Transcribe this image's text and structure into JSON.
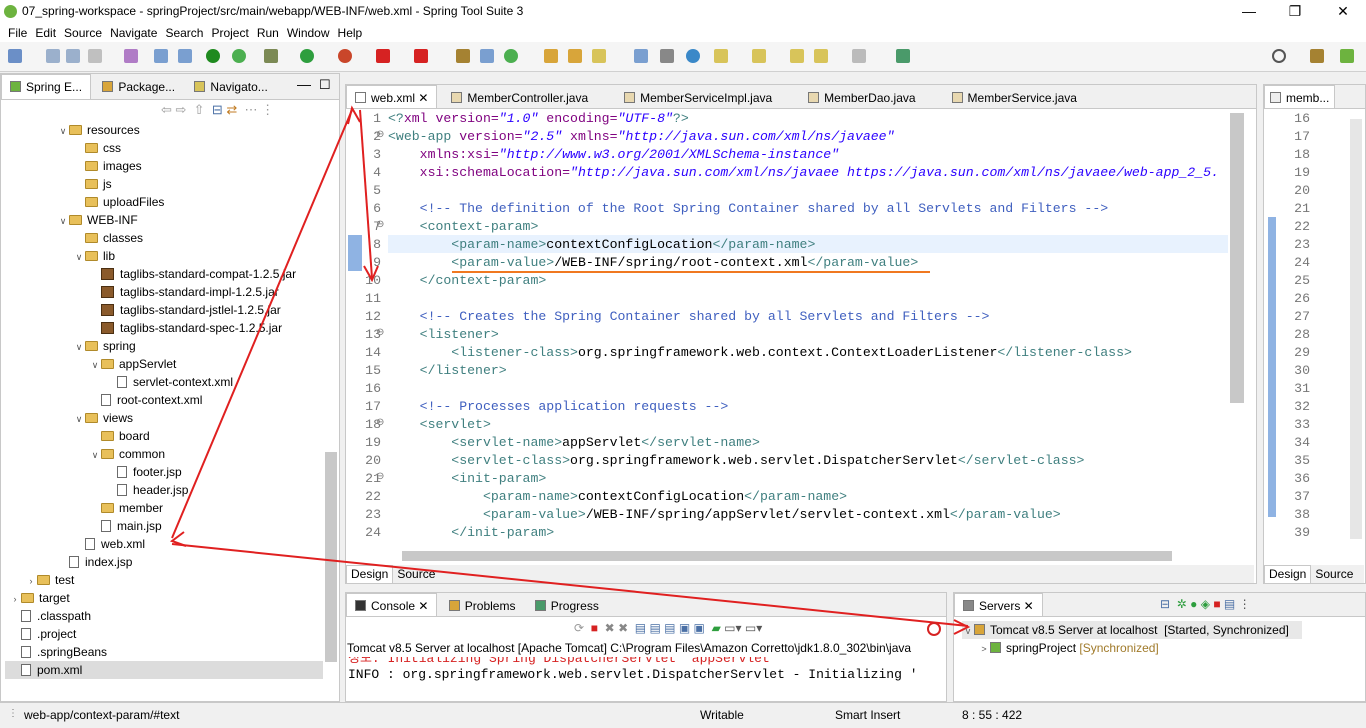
{
  "window": {
    "title": "07_spring-workspace - springProject/src/main/webapp/WEB-INF/web.xml - Spring Tool Suite 3"
  },
  "menu": [
    "File",
    "Edit",
    "Source",
    "Navigate",
    "Search",
    "Project",
    "Run",
    "Window",
    "Help"
  ],
  "left_tabs": [
    "Spring E...",
    "Package...",
    "Navigato..."
  ],
  "tree": [
    {
      "indent": 5,
      "arrow": "v",
      "icon": "folder",
      "label": "resources"
    },
    {
      "indent": 6,
      "arrow": "",
      "icon": "folder",
      "label": "css"
    },
    {
      "indent": 6,
      "arrow": "",
      "icon": "folder",
      "label": "images"
    },
    {
      "indent": 6,
      "arrow": "",
      "icon": "folder",
      "label": "js"
    },
    {
      "indent": 6,
      "arrow": "",
      "icon": "folder",
      "label": "uploadFiles"
    },
    {
      "indent": 5,
      "arrow": "v",
      "icon": "folder",
      "label": "WEB-INF"
    },
    {
      "indent": 6,
      "arrow": "",
      "icon": "folder",
      "label": "classes"
    },
    {
      "indent": 6,
      "arrow": "v",
      "icon": "folder",
      "label": "lib"
    },
    {
      "indent": 7,
      "arrow": "",
      "icon": "jar",
      "label": "taglibs-standard-compat-1.2.5.jar"
    },
    {
      "indent": 7,
      "arrow": "",
      "icon": "jar",
      "label": "taglibs-standard-impl-1.2.5.jar"
    },
    {
      "indent": 7,
      "arrow": "",
      "icon": "jar",
      "label": "taglibs-standard-jstlel-1.2.5.jar"
    },
    {
      "indent": 7,
      "arrow": "",
      "icon": "jar",
      "label": "taglibs-standard-spec-1.2.5.jar"
    },
    {
      "indent": 6,
      "arrow": "v",
      "icon": "folder",
      "label": "spring"
    },
    {
      "indent": 7,
      "arrow": "v",
      "icon": "folder",
      "label": "appServlet"
    },
    {
      "indent": 8,
      "arrow": "",
      "icon": "file",
      "label": "servlet-context.xml"
    },
    {
      "indent": 7,
      "arrow": "",
      "icon": "file",
      "label": "root-context.xml"
    },
    {
      "indent": 6,
      "arrow": "v",
      "icon": "folder",
      "label": "views"
    },
    {
      "indent": 7,
      "arrow": "",
      "icon": "folder",
      "label": "board"
    },
    {
      "indent": 7,
      "arrow": "v",
      "icon": "folder",
      "label": "common"
    },
    {
      "indent": 8,
      "arrow": "",
      "icon": "file",
      "label": "footer.jsp"
    },
    {
      "indent": 8,
      "arrow": "",
      "icon": "file",
      "label": "header.jsp"
    },
    {
      "indent": 7,
      "arrow": "",
      "icon": "folder",
      "label": "member"
    },
    {
      "indent": 7,
      "arrow": "",
      "icon": "file",
      "label": "main.jsp"
    },
    {
      "indent": 6,
      "arrow": "",
      "icon": "file",
      "label": "web.xml"
    },
    {
      "indent": 5,
      "arrow": "",
      "icon": "file",
      "label": "index.jsp"
    },
    {
      "indent": 3,
      "arrow": ">",
      "icon": "folder",
      "label": "test"
    },
    {
      "indent": 2,
      "arrow": ">",
      "icon": "folder",
      "label": "target"
    },
    {
      "indent": 2,
      "arrow": "",
      "icon": "file",
      "label": ".classpath"
    },
    {
      "indent": 2,
      "arrow": "",
      "icon": "file",
      "label": ".project"
    },
    {
      "indent": 2,
      "arrow": "",
      "icon": "file",
      "label": ".springBeans"
    },
    {
      "indent": 2,
      "arrow": "",
      "icon": "file",
      "label": "pom.xml"
    }
  ],
  "editor_tabs": [
    "web.xml",
    "MemberController.java",
    "MemberServiceImpl.java",
    "MemberDao.java",
    "MemberService.java"
  ],
  "right_tab": "memb...",
  "code": [
    {
      "n": "1",
      "fold": "",
      "parts": [
        [
          "tg",
          "<?"
        ],
        [
          "an",
          "xml "
        ],
        [
          "an",
          "version="
        ],
        [
          "av",
          "\"1.0\""
        ],
        [
          "an",
          " encoding="
        ],
        [
          "av",
          "\"UTF-8\""
        ],
        [
          "tg",
          "?>"
        ]
      ]
    },
    {
      "n": "2",
      "fold": "⊖",
      "parts": [
        [
          "tg",
          "<web-app "
        ],
        [
          "an",
          "version="
        ],
        [
          "av",
          "\"2.5\""
        ],
        [
          "an",
          " xmlns="
        ],
        [
          "av",
          "\"http://java.sun.com/xml/ns/javaee\""
        ]
      ]
    },
    {
      "n": "3",
      "fold": "",
      "parts": [
        [
          "an",
          "    xmlns:xsi="
        ],
        [
          "av",
          "\"http://www.w3.org/2001/XMLSchema-instance\""
        ]
      ]
    },
    {
      "n": "4",
      "fold": "",
      "parts": [
        [
          "an",
          "    xsi:schemaLocation="
        ],
        [
          "av",
          "\"http://java.sun.com/xml/ns/javaee https://java.sun.com/xml/ns/javaee/web-app_2_5."
        ]
      ]
    },
    {
      "n": "5",
      "fold": "",
      "parts": []
    },
    {
      "n": "6",
      "fold": "",
      "parts": [
        [
          "cm",
          "    <!-- The definition of the Root Spring Container shared by all Servlets and Filters -->"
        ]
      ]
    },
    {
      "n": "7",
      "fold": "⊖",
      "parts": [
        [
          "tg",
          "    <context-param>"
        ]
      ]
    },
    {
      "n": "8",
      "fold": "",
      "parts": [
        [
          "tg",
          "        <param-name>"
        ],
        [
          "tx",
          "contextConfigLocation"
        ],
        [
          "tg",
          "</param-name>"
        ]
      ]
    },
    {
      "n": "9",
      "fold": "",
      "parts": [
        [
          "tg",
          "        <param-value>"
        ],
        [
          "tx",
          "/WEB-INF/spring/root-context.xml"
        ],
        [
          "tg",
          "</param-value>"
        ]
      ]
    },
    {
      "n": "10",
      "fold": "",
      "parts": [
        [
          "tg",
          "    </context-param>"
        ]
      ]
    },
    {
      "n": "11",
      "fold": "",
      "parts": []
    },
    {
      "n": "12",
      "fold": "",
      "parts": [
        [
          "cm",
          "    <!-- Creates the Spring Container shared by all Servlets and Filters -->"
        ]
      ]
    },
    {
      "n": "13",
      "fold": "⊖",
      "parts": [
        [
          "tg",
          "    <listener>"
        ]
      ]
    },
    {
      "n": "14",
      "fold": "",
      "parts": [
        [
          "tg",
          "        <listener-class>"
        ],
        [
          "tx",
          "org.springframework.web.context.ContextLoaderListener"
        ],
        [
          "tg",
          "</listener-class>"
        ]
      ]
    },
    {
      "n": "15",
      "fold": "",
      "parts": [
        [
          "tg",
          "    </listener>"
        ]
      ]
    },
    {
      "n": "16",
      "fold": "",
      "parts": []
    },
    {
      "n": "17",
      "fold": "",
      "parts": [
        [
          "cm",
          "    <!-- Processes application requests -->"
        ]
      ]
    },
    {
      "n": "18",
      "fold": "⊖",
      "parts": [
        [
          "tg",
          "    <servlet>"
        ]
      ]
    },
    {
      "n": "19",
      "fold": "",
      "parts": [
        [
          "tg",
          "        <servlet-name>"
        ],
        [
          "tx",
          "appServlet"
        ],
        [
          "tg",
          "</servlet-name>"
        ]
      ]
    },
    {
      "n": "20",
      "fold": "",
      "parts": [
        [
          "tg",
          "        <servlet-class>"
        ],
        [
          "tx",
          "org.springframework.web.servlet.DispatcherServlet"
        ],
        [
          "tg",
          "</servlet-class>"
        ]
      ]
    },
    {
      "n": "21",
      "fold": "⊖",
      "parts": [
        [
          "tg",
          "        <init-param>"
        ]
      ]
    },
    {
      "n": "22",
      "fold": "",
      "parts": [
        [
          "tg",
          "            <param-name>"
        ],
        [
          "tx",
          "contextConfigLocation"
        ],
        [
          "tg",
          "</param-name>"
        ]
      ]
    },
    {
      "n": "23",
      "fold": "",
      "parts": [
        [
          "tg",
          "            <param-value>"
        ],
        [
          "tx",
          "/WEB-INF/spring/appServlet/servlet-context.xml"
        ],
        [
          "tg",
          "</param-value>"
        ]
      ]
    },
    {
      "n": "24",
      "fold": "",
      "parts": [
        [
          "tg",
          "        </init-param>"
        ]
      ]
    }
  ],
  "right_lines": [
    "16",
    "17",
    "18",
    "19",
    "20",
    "21",
    "22",
    "23",
    "24",
    "25",
    "26",
    "27",
    "28",
    "29",
    "30",
    "31",
    "32",
    "33",
    "34",
    "35",
    "36",
    "37",
    "38",
    "39"
  ],
  "editor_bottom_tabs": [
    "Design",
    "Source"
  ],
  "console": {
    "tabs": [
      "Console",
      "Problems",
      "Progress"
    ],
    "header": "Tomcat v8.5 Server at localhost [Apache Tomcat] C:\\Program Files\\Amazon Corretto\\jdk1.8.0_302\\bin\\java",
    "lines": [
      "정보: Initializing Spring DispatcherServlet 'appServlet'",
      "INFO : org.springframework.web.servlet.DispatcherServlet - Initializing '"
    ]
  },
  "servers": {
    "tab": "Servers",
    "server": "Tomcat v8.5 Server at localhost",
    "server_state": "[Started, Synchronized]",
    "project": "springProject",
    "project_state": "[Synchronized]"
  },
  "status": {
    "path": "web-app/context-param/#text",
    "mode": "Writable",
    "insert": "Smart Insert",
    "pos": "8 : 55 : 422"
  },
  "colors": {
    "annotation": "#e02020",
    "underline": "#f07820"
  }
}
